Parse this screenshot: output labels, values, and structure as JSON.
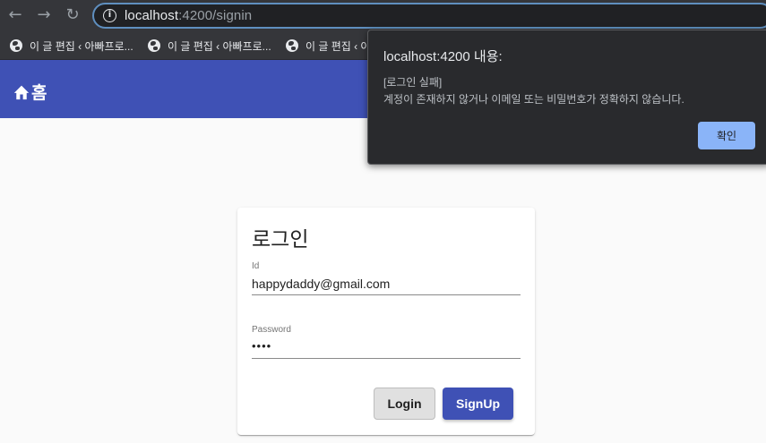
{
  "browser": {
    "url_host": "localhost",
    "url_rest": ":4200/signin",
    "bookmarks": [
      {
        "label": "이 글 편집 ‹ 아빠프로..."
      },
      {
        "label": "이 글 편집 ‹ 아빠프로..."
      },
      {
        "label": "이 글 편집 ‹ 아"
      }
    ]
  },
  "header": {
    "home_label": "홈"
  },
  "dialog": {
    "title": "localhost:4200 내용:",
    "message_line1": "[로그인 실패]",
    "message_line2": "계정이 존재하지 않거나 이메일 또는 비밀번호가 정확하지 않습니다.",
    "ok_label": "확인"
  },
  "login": {
    "title": "로그인",
    "id_label": "Id",
    "id_value": "happydaddy@gmail.com",
    "password_label": "Password",
    "password_value": "••••",
    "login_button": "Login",
    "signup_button": "SignUp"
  },
  "colors": {
    "primary": "#3f51b5",
    "dialog_bg": "#292a2d",
    "dialog_button": "#8ab4f8"
  }
}
